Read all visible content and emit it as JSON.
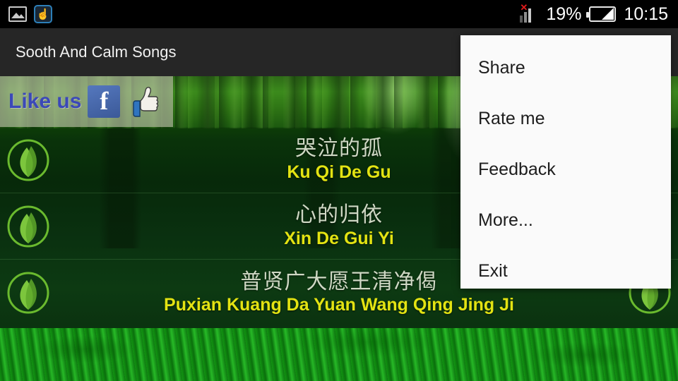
{
  "statusbar": {
    "left_icons": [
      {
        "name": "screenshot-icon",
        "glyph": ""
      },
      {
        "name": "touch-pointer-icon",
        "glyph": "☝"
      }
    ],
    "signal": {
      "name": "signal-no-service-icon",
      "x_mark": "✕"
    },
    "battery_percent": "19%",
    "battery_icon": "battery-icon",
    "time": "10:15"
  },
  "actionbar": {
    "title": "Sooth And Calm Songs",
    "overflow_icon": "overflow-menu-icon"
  },
  "banner": {
    "like_text": "Like us",
    "facebook_glyph": "f",
    "thumb_glyph": "👍",
    "facebook_icon": "facebook-icon",
    "thumbs_up_icon": "thumbs-up-icon"
  },
  "songs": [
    {
      "chinese": "哭泣的孤",
      "pinyin": "Ku Qi De Gu"
    },
    {
      "chinese": "心的归依",
      "pinyin": "Xin De Gui Yi"
    },
    {
      "chinese": "普贤广大愿王清净偈",
      "pinyin": "Puxian Kuang Da Yuan Wang Qing Jing Ji"
    }
  ],
  "menu": {
    "items": [
      {
        "label": "Share"
      },
      {
        "label": "Rate me"
      },
      {
        "label": "Feedback"
      },
      {
        "label": "More..."
      },
      {
        "label": "Exit"
      }
    ]
  },
  "colors": {
    "accent_yellow": "#e3e312",
    "chinese_text": "#cfd8c4",
    "actionbar_bg": "#262626",
    "statusbar_bg": "#000000",
    "menu_bg": "#fafafa",
    "like_blue": "#3b48b8",
    "facebook_blue": "#3b5998",
    "leaf_green": "#6aba2e"
  }
}
